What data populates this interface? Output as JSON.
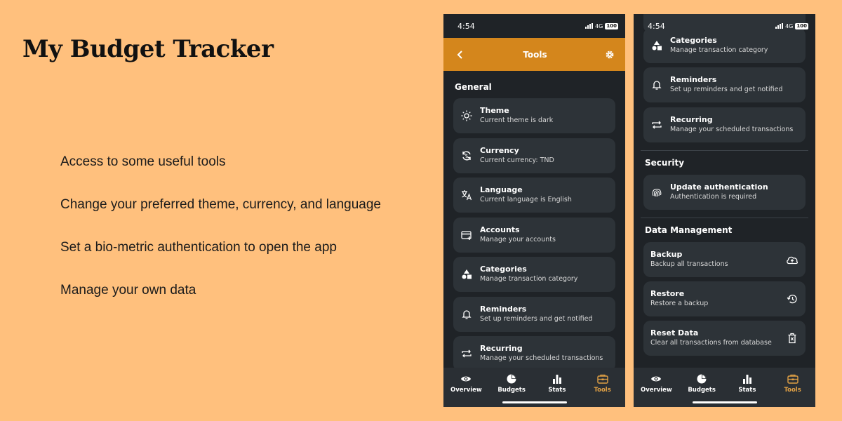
{
  "promo": {
    "title": "My Budget Tracker",
    "features": [
      "Access to some useful tools",
      "Change your preferred theme, currency, and language",
      "Set a bio-metric authentication to open the app",
      "Manage your own data"
    ]
  },
  "status_bar": {
    "time": "4:54",
    "network": "4G",
    "battery": "100"
  },
  "app_bar": {
    "title": "Tools"
  },
  "sections": {
    "general": "General",
    "security": "Security",
    "data_management": "Data Management"
  },
  "general_items": [
    {
      "title": "Theme",
      "subtitle": "Current theme is dark",
      "icon": "sun-icon"
    },
    {
      "title": "Currency",
      "subtitle": "Current currency: TND",
      "icon": "currency-exchange-icon"
    },
    {
      "title": "Language",
      "subtitle": "Current language is English",
      "icon": "translate-icon"
    },
    {
      "title": "Accounts",
      "subtitle": "Manage your accounts",
      "icon": "card-add-icon"
    },
    {
      "title": "Categories",
      "subtitle": "Manage transaction category",
      "icon": "shapes-icon"
    },
    {
      "title": "Reminders",
      "subtitle": "Set up reminders and get notified",
      "icon": "bell-icon"
    },
    {
      "title": "Recurring",
      "subtitle": "Manage your scheduled transactions",
      "icon": "repeat-icon"
    }
  ],
  "security_items": [
    {
      "title": "Update authentication",
      "subtitle": "Authentication is required",
      "icon": "fingerprint-icon"
    }
  ],
  "data_items": [
    {
      "title": "Backup",
      "subtitle": "Backup all transactions",
      "icon": "cloud-upload-icon"
    },
    {
      "title": "Restore",
      "subtitle": "Restore a backup",
      "icon": "history-icon"
    },
    {
      "title": "Reset Data",
      "subtitle": "Clear all transactions from database",
      "icon": "trash-icon"
    }
  ],
  "nav": [
    {
      "label": "Overview",
      "icon": "eye-icon"
    },
    {
      "label": "Budgets",
      "icon": "pie-chart-icon"
    },
    {
      "label": "Stats",
      "icon": "bar-chart-icon"
    },
    {
      "label": "Tools",
      "icon": "toolbox-icon"
    }
  ],
  "colors": {
    "background": "#FFC07D",
    "app_bar": "#D4861C",
    "phone_bg": "#1F2327",
    "card_bg": "#2D3338",
    "nav_active": "#E0A045"
  }
}
